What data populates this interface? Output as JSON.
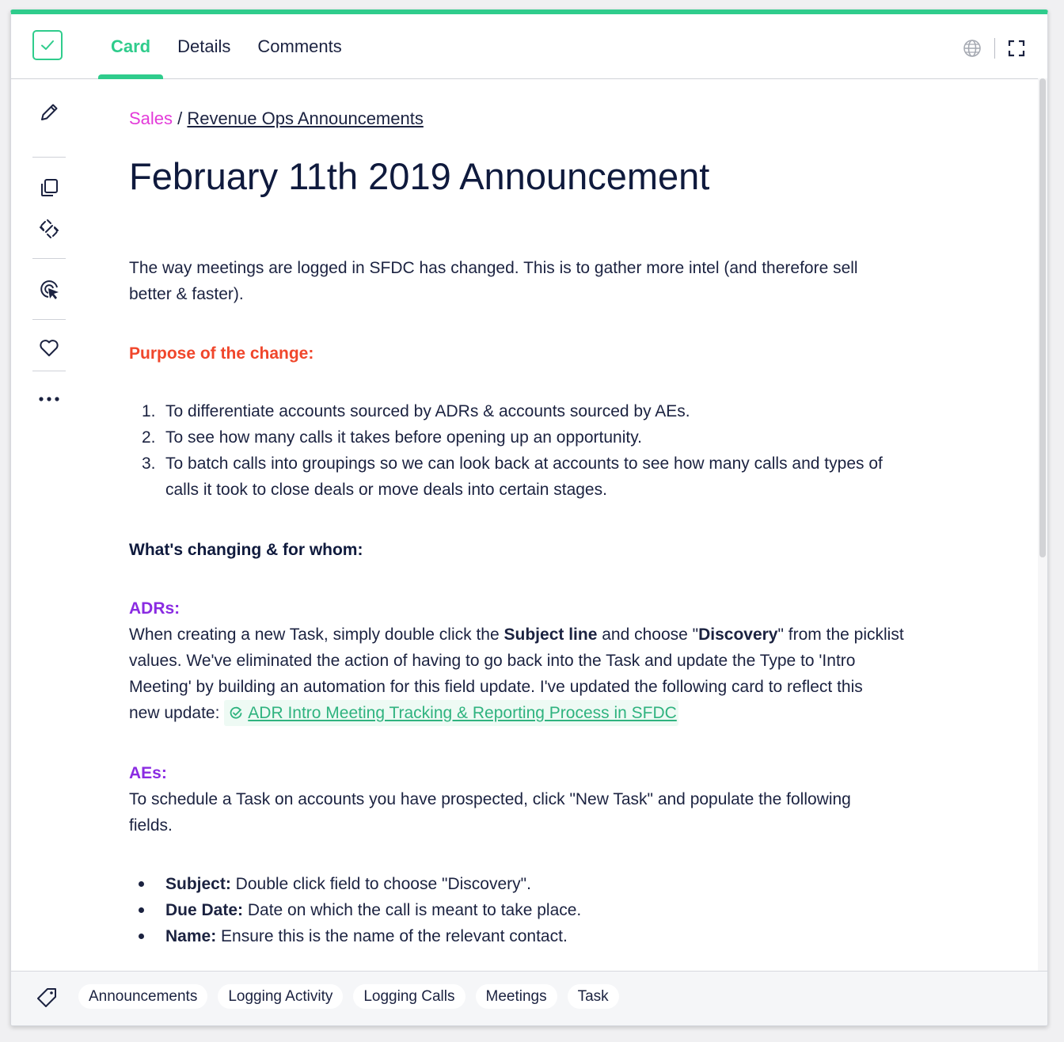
{
  "header": {
    "tabs": [
      {
        "label": "Card",
        "active": true
      },
      {
        "label": "Details",
        "active": false
      },
      {
        "label": "Comments",
        "active": false
      }
    ]
  },
  "breadcrumb": {
    "collection": "Sales",
    "separator": "/",
    "board": "Revenue Ops Announcements"
  },
  "title": "February 11th 2019 Announcement",
  "body": {
    "intro_line1": "The way meetings are logged in SFDC has changed. This is to gather more intel (and therefore sell",
    "intro_line2": "better & faster).",
    "purpose_heading": "Purpose of the change:",
    "purpose_items": [
      {
        "num": "1.",
        "lines": [
          "To differentiate accounts sourced by ADRs & accounts sourced by AEs."
        ]
      },
      {
        "num": "2.",
        "lines": [
          "To see how many calls it takes before opening up an opportunity."
        ]
      },
      {
        "num": "3.",
        "lines": [
          "To batch calls into groupings so we can look back at accounts to see how many calls and types of",
          "calls it took to close deals or move deals into certain stages."
        ]
      }
    ],
    "changing_heading": "What's changing & for whom:",
    "adrs_heading": "ADRs:",
    "adrs": {
      "l1_a": "When creating a new Task, simply double click the ",
      "l1_b": "Subject line",
      "l1_c": " and choose \"",
      "l1_d": "Discovery",
      "l1_e": "\" from the picklist",
      "l2": "values. We've eliminated the action of having to go back into the Task and update the Type to 'Intro",
      "l3": "Meeting' by building an automation for this field update. I've updated the following card to reflect this",
      "l4": "new update: ",
      "link": "ADR Intro Meeting Tracking & Reporting Process in SFDC"
    },
    "aes_heading": "AEs:",
    "aes_line1": "To schedule a Task on accounts you have prospected,  click \"New Task\" and populate the following",
    "aes_line2": "fields.",
    "fields": [
      {
        "label": "Subject:",
        "text": " Double click field to choose \"Discovery\"."
      },
      {
        "label": "Due Date:",
        "text": " Date on which the call is meant to take place."
      },
      {
        "label": "Name:",
        "text": " Ensure this is the name of the relevant contact."
      }
    ]
  },
  "footer": {
    "tags": [
      "Announcements",
      "Logging Activity",
      "Logging Calls",
      "Meetings",
      "Task"
    ]
  },
  "colors": {
    "accent": "#2fcc8c",
    "collection": "#e33bd9",
    "purpose": "#f0462b",
    "role_heading": "#8a2be2"
  },
  "icons": [
    "check-icon",
    "globe-icon",
    "fullscreen-icon",
    "pencil-icon",
    "copy-icon",
    "unlink-icon",
    "cursor-target-icon",
    "heart-icon",
    "more-icon",
    "tag-icon",
    "card-link-icon"
  ]
}
